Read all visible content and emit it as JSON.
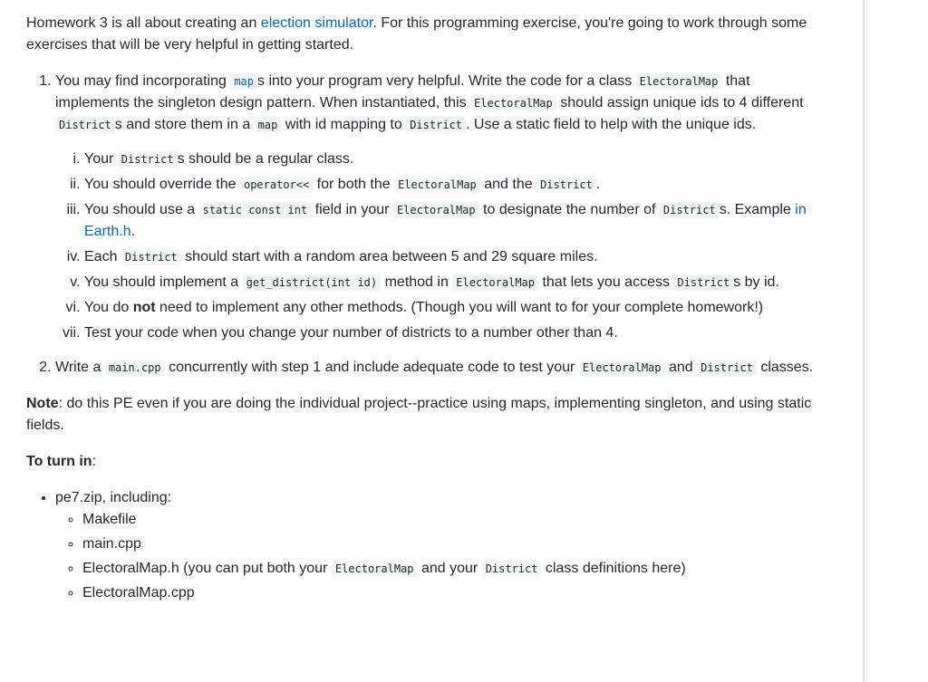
{
  "intro": {
    "pre": "Homework 3 is all about creating an ",
    "link": "election simulator",
    "post": ". For this programming exercise, you're going to work through some exercises that will be very helpful in getting started."
  },
  "steps": [
    {
      "parts": {
        "t1": "You may find incorporating ",
        "c1": "map",
        "t2": "s into your program very helpful. Write the code for a class ",
        "c2": "ElectoralMap",
        "t3": " that implements the singleton design pattern. When instantiated, this ",
        "c3": "ElectoralMap",
        "t4": " should assign unique ids to 4 different ",
        "c4": "District",
        "t5": "s and store them in a ",
        "c5": "map",
        "t6": " with id mapping to ",
        "c6": "District",
        "t7": ". Use a static field to help with the unique ids."
      },
      "subitems": [
        {
          "t1": "Your ",
          "c1": "District",
          "t2": "s should be a regular class."
        },
        {
          "t1": "You should override the ",
          "c1": "operator<<",
          "t2": " for both the ",
          "c2": "ElectoralMap",
          "t3": " and the ",
          "c3": "District",
          "t4": "."
        },
        {
          "t1": "You should use a ",
          "c1": "static const int",
          "t2": " field in your ",
          "c2": "ElectoralMap",
          "t3": " to designate the number of ",
          "c3": "District",
          "t4": "s. Example ",
          "link": "in Earth.h",
          "t5": "."
        },
        {
          "t1": "Each ",
          "c1": "District",
          "t2": " should start with a random area between 5 and 29 square miles."
        },
        {
          "t1": "You should implement a ",
          "c1": "get_district(int id)",
          "t2": " method in ",
          "c2": "ElectoralMap",
          "t3": " that lets you access ",
          "c3": "District",
          "t4": "s by id."
        },
        {
          "t1": "You do ",
          "bold": "not",
          "t2": " need to implement any other methods. (Though you will want to for your complete homework!)"
        },
        {
          "t1": "Test your code when you change your number of districts to a number other than 4."
        }
      ]
    },
    {
      "parts": {
        "t1": "Write a ",
        "c1": "main.cpp",
        "t2": " concurrently with step 1 and include adequate code to test your ",
        "c2": "ElectoralMap",
        "t3": " and ",
        "c3": "District",
        "t4": " classes."
      }
    }
  ],
  "note": {
    "label": "Note",
    "text": ": do this PE even if you are doing the individual project--practice using maps, implementing singleton, and using static fields."
  },
  "turnin": {
    "label": "To turn in",
    "colon": ":",
    "zip": "pe7.zip, including:",
    "files": [
      {
        "name": "Makefile"
      },
      {
        "name": "main.cpp"
      },
      {
        "name": "ElectoralMap.h (you can put both your ",
        "c1": "ElectoralMap",
        "t2": " and your ",
        "c2": "District",
        "t3": " class definitions here)"
      },
      {
        "name": "ElectoralMap.cpp"
      }
    ]
  }
}
